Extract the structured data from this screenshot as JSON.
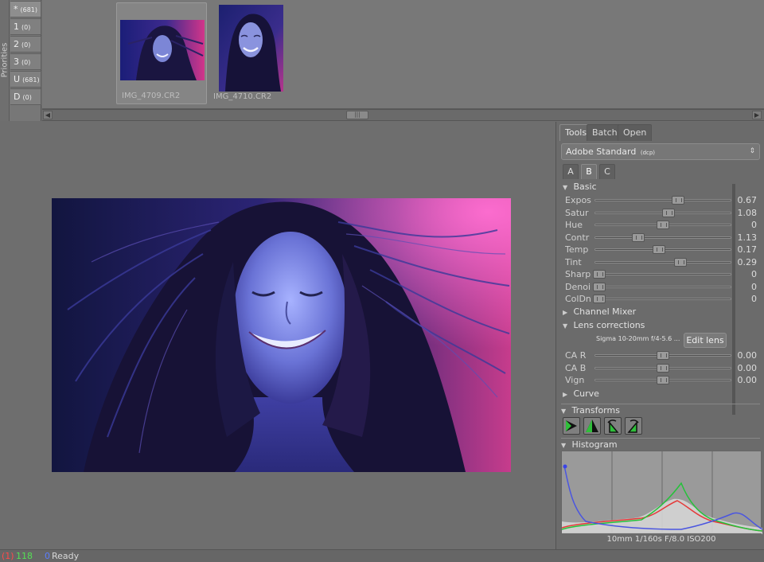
{
  "priorities": {
    "label": "Priorities",
    "items": [
      {
        "label": "*",
        "count": "(681)"
      },
      {
        "label": "1",
        "count": "(0)"
      },
      {
        "label": "2",
        "count": "(0)"
      },
      {
        "label": "3",
        "count": "(0)"
      },
      {
        "label": "U",
        "count": "(681)"
      },
      {
        "label": "D",
        "count": "(0)"
      }
    ]
  },
  "filmstrip": {
    "thumbnails": [
      {
        "caption": "IMG_4709.CR2",
        "selected": true
      },
      {
        "caption": "IMG_4710.CR2",
        "selected": false
      }
    ]
  },
  "panel": {
    "tabs": [
      "Tools",
      "Batch",
      "Open"
    ],
    "active_tab": "Tools",
    "profile": {
      "name": "Adobe Standard",
      "suffix": "(dcp)"
    },
    "sub_tabs": [
      "A",
      "B",
      "C"
    ],
    "active_sub_tab": "B",
    "basic": {
      "title": "Basic",
      "sliders": [
        {
          "label": "Expos",
          "value": "0.67",
          "fraction": 0.61
        },
        {
          "label": "Satur",
          "value": "1.08",
          "fraction": 0.54
        },
        {
          "label": "Hue",
          "value": "0",
          "fraction": 0.5
        },
        {
          "label": "Contr",
          "value": "1.13",
          "fraction": 0.32
        },
        {
          "label": "Temp",
          "value": "0.17",
          "fraction": 0.47
        },
        {
          "label": "Tint",
          "value": "0.29",
          "fraction": 0.63
        },
        {
          "label": "Sharp",
          "value": "0",
          "fraction": 0.03
        },
        {
          "label": "Denoi",
          "value": "0",
          "fraction": 0.03
        },
        {
          "label": "ColDn",
          "value": "0",
          "fraction": 0.03
        }
      ]
    },
    "channel_mixer": {
      "title": "Channel Mixer"
    },
    "lens": {
      "title": "Lens corrections",
      "lens_name": "Sigma 10-20mm f/4-5.6 ...",
      "edit_button": "Edit lens",
      "sliders": [
        {
          "label": "CA R",
          "value": "0.00",
          "fraction": 0.5
        },
        {
          "label": "CA B",
          "value": "0.00",
          "fraction": 0.5
        },
        {
          "label": "Vign",
          "value": "0.00",
          "fraction": 0.5
        }
      ]
    },
    "curve": {
      "title": "Curve"
    },
    "transforms": {
      "title": "Transforms"
    },
    "histogram": {
      "title": "Histogram",
      "info": "10mm 1/160s F/8.0 ISO200"
    }
  },
  "status": {
    "red": "(1)",
    "green": "118",
    "blue": "0",
    "text": "Ready"
  }
}
